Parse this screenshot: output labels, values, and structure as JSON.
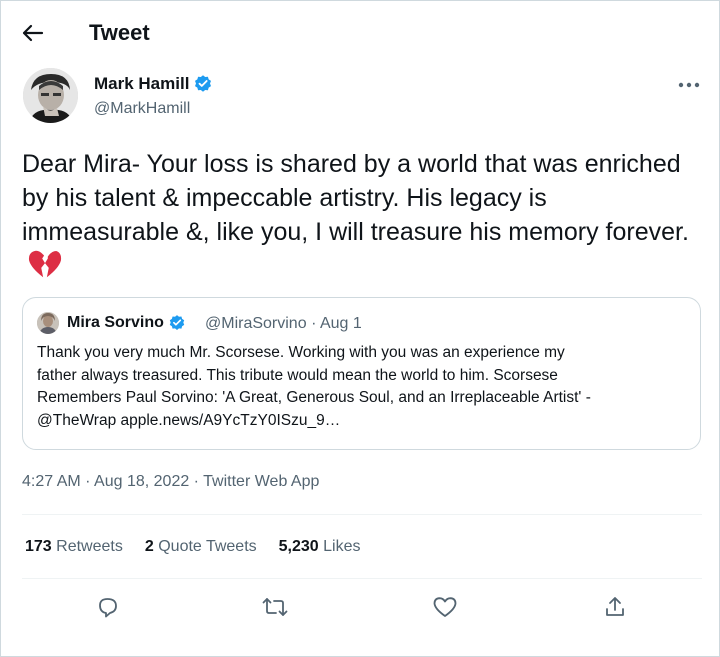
{
  "header": {
    "title": "Tweet",
    "back_icon": "arrow-left-icon"
  },
  "tweet": {
    "author": {
      "name": "Mark Hamill",
      "handle": "@MarkHamill",
      "verified": true
    },
    "text": "Dear Mira- Your loss is shared by a world that was enriched by his talent & impeccable artistry. His legacy is immeasurable &, like you, I will treasure his memory forever.",
    "emoji": "broken-heart-icon",
    "timestamp": "4:27 AM · Aug 18, 2022 · Twitter Web App"
  },
  "quote": {
    "author": {
      "name": "Mira Sorvino",
      "handle": "@MiraSorvino",
      "date": "Aug 1",
      "verified": true
    },
    "lines": [
      "Thank you very much Mr. Scorsese. Working with you was an experience my",
      "father always treasured. This tribute would mean the world to him.  Scorsese",
      "Remembers Paul Sorvino: 'A Great, Generous Soul, and an Irreplaceable Artist' -",
      "@TheWrap  apple.news/A9YcTzY0ISzu_9…"
    ]
  },
  "stats": {
    "retweets_count": "173",
    "retweets_label": "Retweets",
    "quotes_count": "2",
    "quotes_label": "Quote Tweets",
    "likes_count": "5,230",
    "likes_label": "Likes"
  },
  "actions": [
    "reply-icon",
    "retweet-icon",
    "like-icon",
    "share-icon"
  ],
  "colors": {
    "verified": "#1d9bf0",
    "secondary_text": "#536471",
    "border": "#cfd9de",
    "broken_heart": "#dd2e44"
  }
}
